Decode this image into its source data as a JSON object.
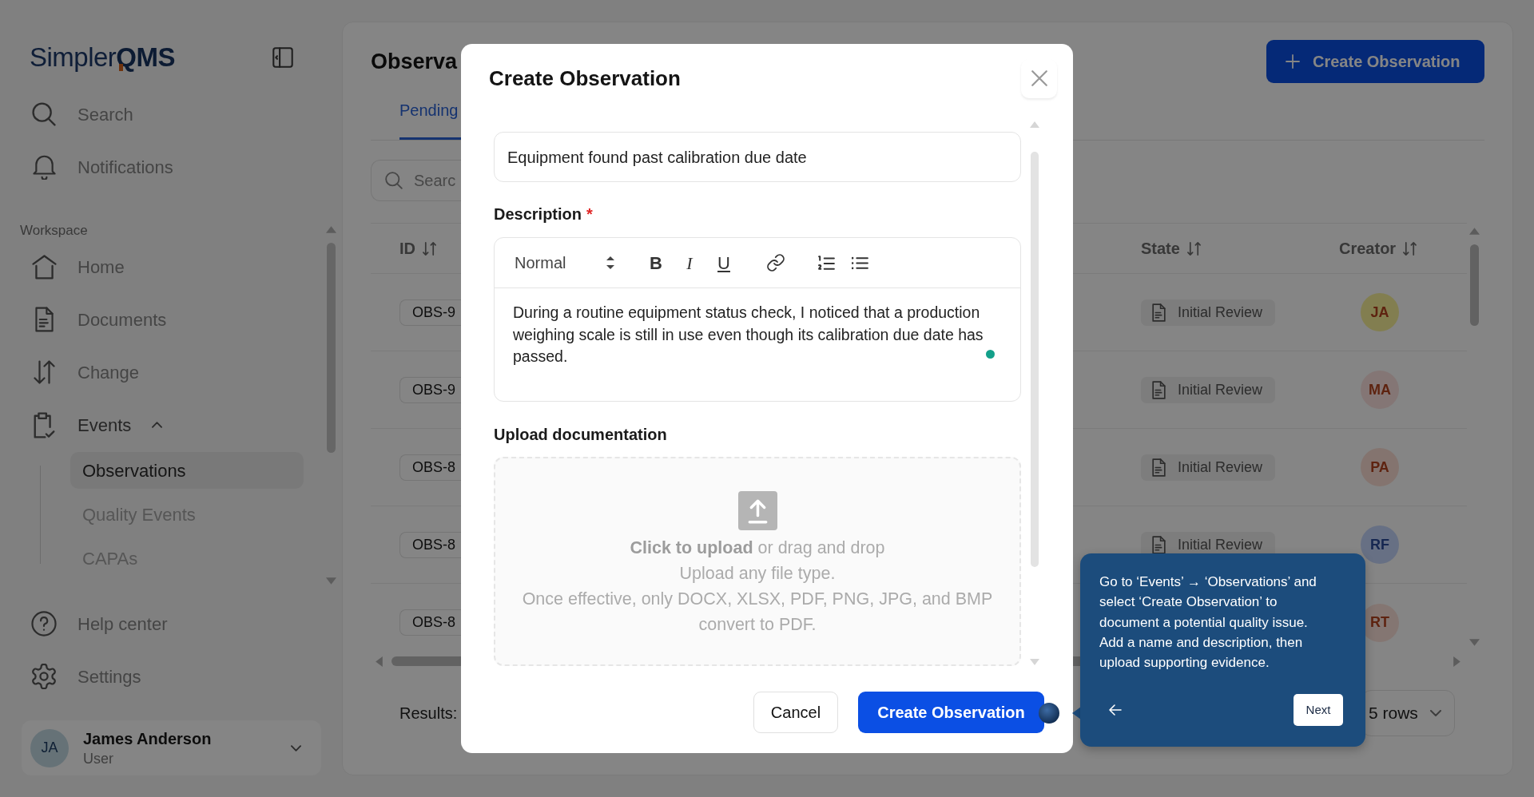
{
  "sidebar": {
    "brand": "Simpler**QMS**",
    "top_items": [
      {
        "label": "Search",
        "selected": false
      },
      {
        "label": "Notifications",
        "selected": false
      }
    ],
    "section": {
      "label": "Workspace",
      "items": [
        {
          "label": "Home",
          "selected": false
        },
        {
          "label": "Documents",
          "selected": false
        },
        {
          "label": "Change",
          "selected": false
        },
        {
          "label": "Events",
          "selected": false,
          "expanded": true,
          "children": [
            {
              "label": "Observations",
              "selected": true
            },
            {
              "label": "Quality Events",
              "selected": false
            },
            {
              "label": "CAPAs",
              "selected": false
            }
          ]
        }
      ]
    },
    "bottom_items": [
      {
        "label": "Help center",
        "selected": false
      },
      {
        "label": "Settings",
        "selected": false
      }
    ],
    "user": {
      "initials": "JA",
      "name": "James Anderson",
      "role": "User"
    }
  },
  "page": {
    "title": "Observa",
    "create_button": "Create Observation",
    "tabs": [
      {
        "label": "Pending",
        "selected": true
      }
    ],
    "search": {
      "placeholder": "Searc"
    },
    "table": {
      "columns": [
        "ID",
        "State",
        "Creator"
      ],
      "rows": [
        {
          "id": "OBS-9",
          "state": "Initial Review",
          "creator": "JA",
          "color": "#827e50"
        },
        {
          "id": "OBS-9",
          "state": "Initial Review",
          "creator": "MA",
          "color": "#847675"
        },
        {
          "id": "OBS-8",
          "state": "Initial Review",
          "creator": "PA",
          "color": "#84746f"
        },
        {
          "id": "OBS-8",
          "state": "Initial Review",
          "creator": "RF",
          "color": "#677084"
        },
        {
          "id": "OBS-8",
          "creator": "RT",
          "color": "#847672"
        }
      ]
    },
    "results_label": "Results:",
    "rows_select": "5 rows"
  },
  "modal": {
    "title": "Create Observation",
    "name_value": "Equipment found past calibration due date",
    "description": {
      "label": "Description",
      "required_mark": "*",
      "format": "Normal",
      "format_buttons": [
        {
          "kind": "bold",
          "glyph": "B"
        },
        {
          "kind": "italic",
          "glyph": "I"
        },
        {
          "kind": "underline",
          "glyph": "U"
        }
      ],
      "text": "During a routine equipment status check, I noticed that a production weighing scale is still in use even though its calibration due date has passed."
    },
    "upload": {
      "label": "Upload documentation",
      "prompt": "**Click to upload** or drag and drop",
      "hint": "Upload any file type.",
      "note": "Once effective, only DOCX, XLSX, PDF, PNG, JPG, and BMP convert to PDF."
    },
    "buttons": {
      "cancel": "Cancel",
      "submit": "Create Observation"
    }
  },
  "tour_tooltip": {
    "text": "Go to ‘Events’ → ‘Observations’ and select ‘Create Observation’ to document a potential quality issue. Add a name and description, then upload supporting evidence.",
    "next": "Next"
  }
}
